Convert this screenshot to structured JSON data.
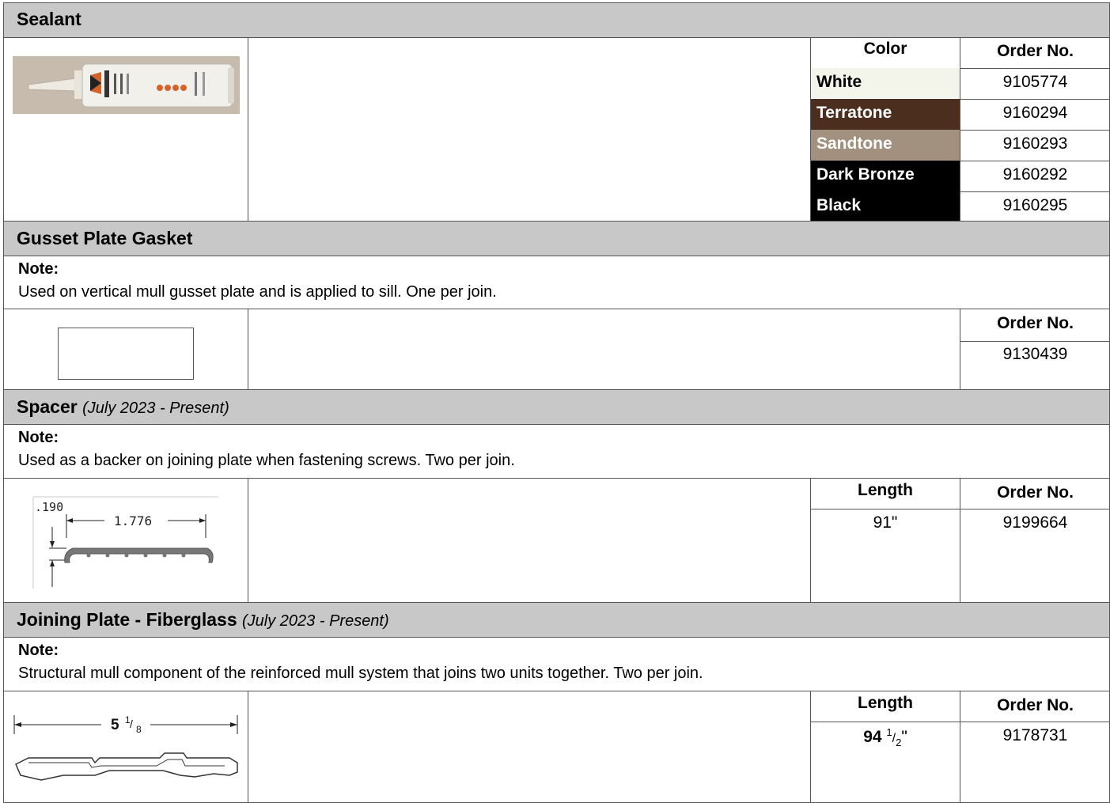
{
  "sealant": {
    "title": "Sealant",
    "color_header": "Color",
    "order_header": "Order No.",
    "rows": [
      {
        "color": "White",
        "order": "9105774",
        "bg": "#f4f5ea",
        "fg": "#000000"
      },
      {
        "color": "Terratone",
        "order": "9160294",
        "bg": "#4b2e1e",
        "fg": "#ffffff"
      },
      {
        "color": "Sandtone",
        "order": "9160293",
        "bg": "#a3917f",
        "fg": "#ffffff"
      },
      {
        "color": "Dark Bronze",
        "order": "9160292",
        "bg": "#000000",
        "fg": "#ffffff"
      },
      {
        "color": "Black",
        "order": "9160295",
        "bg": "#000000",
        "fg": "#ffffff"
      }
    ],
    "image_label": "ANDERSEN SEALANT"
  },
  "gasket": {
    "title": "Gusset Plate Gasket",
    "note_label": "Note:",
    "note_text": "Used on vertical mull gusset plate and is applied to sill. One per join.",
    "order_header": "Order No.",
    "order": "9130439"
  },
  "spacer": {
    "title": "Spacer",
    "date": "(July 2023 - Present)",
    "note_label": "Note:",
    "note_text": "Used as a backer on joining plate when fastening screws. Two per join.",
    "length_header": "Length",
    "order_header": "Order No.",
    "length": "91\"",
    "order": "9199664",
    "dim_height": ".190",
    "dim_width": "1.776"
  },
  "joining": {
    "title": "Joining Plate - Fiberglass",
    "date": "(July 2023 - Present)",
    "note_label": "Note:",
    "note_text": "Structural mull component of the reinforced mull system that joins two units together. Two per join.",
    "length_header": "Length",
    "order_header": "Order No.",
    "length_whole": "94",
    "length_num": "1",
    "length_den": "2",
    "length_unit": "\"",
    "order": "9178731",
    "dim_whole": "5",
    "dim_num": "1",
    "dim_den": "8"
  }
}
